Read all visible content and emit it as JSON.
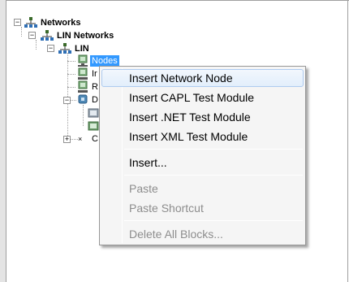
{
  "tree": {
    "networks": "Networks",
    "lin_networks": "LIN Networks",
    "lin": "LIN",
    "nodes": "Nodes",
    "partial_items": [
      "Ir",
      "R",
      "D",
      "C"
    ]
  },
  "context_menu": {
    "items": [
      {
        "label": "Insert Network Node"
      },
      {
        "label": "Insert CAPL Test Module"
      },
      {
        "label": "Insert .NET Test Module"
      },
      {
        "label": "Insert XML Test Module"
      },
      {
        "label": "Insert..."
      },
      {
        "label": "Paste"
      },
      {
        "label": "Paste Shortcut"
      },
      {
        "label": "Delete All Blocks..."
      }
    ]
  },
  "colors": {
    "selection": "#3399ff",
    "menu_bg": "#f5f5f5",
    "menu_hover": "#e2eefb",
    "disabled_text": "#8d8d8d"
  },
  "icons": [
    "network-icon",
    "node-icon",
    "expander-minus-icon",
    "expander-plus-icon"
  ]
}
